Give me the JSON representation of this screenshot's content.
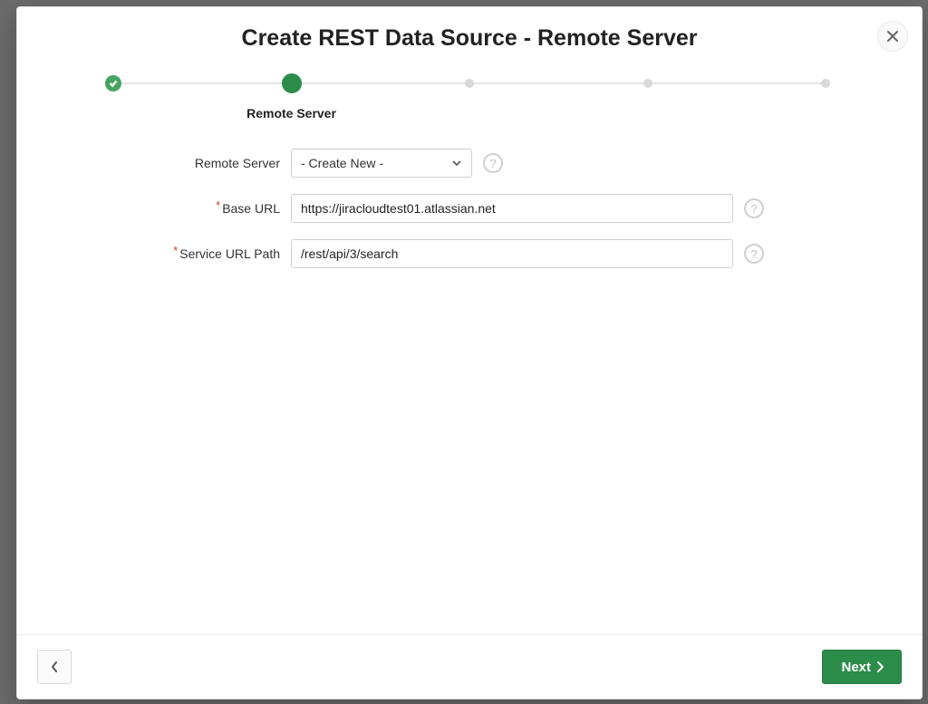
{
  "dialog": {
    "title": "Create REST Data Source - Remote Server"
  },
  "wizard": {
    "current_step_label": "Remote Server"
  },
  "form": {
    "remote_server": {
      "label": "Remote Server",
      "selected": "- Create New -"
    },
    "base_url": {
      "label": "Base URL",
      "value": "https://jiracloudtest01.atlassian.net"
    },
    "service_url_path": {
      "label": "Service URL Path",
      "value": "/rest/api/3/search"
    }
  },
  "buttons": {
    "next": "Next"
  },
  "help_glyph": "?"
}
